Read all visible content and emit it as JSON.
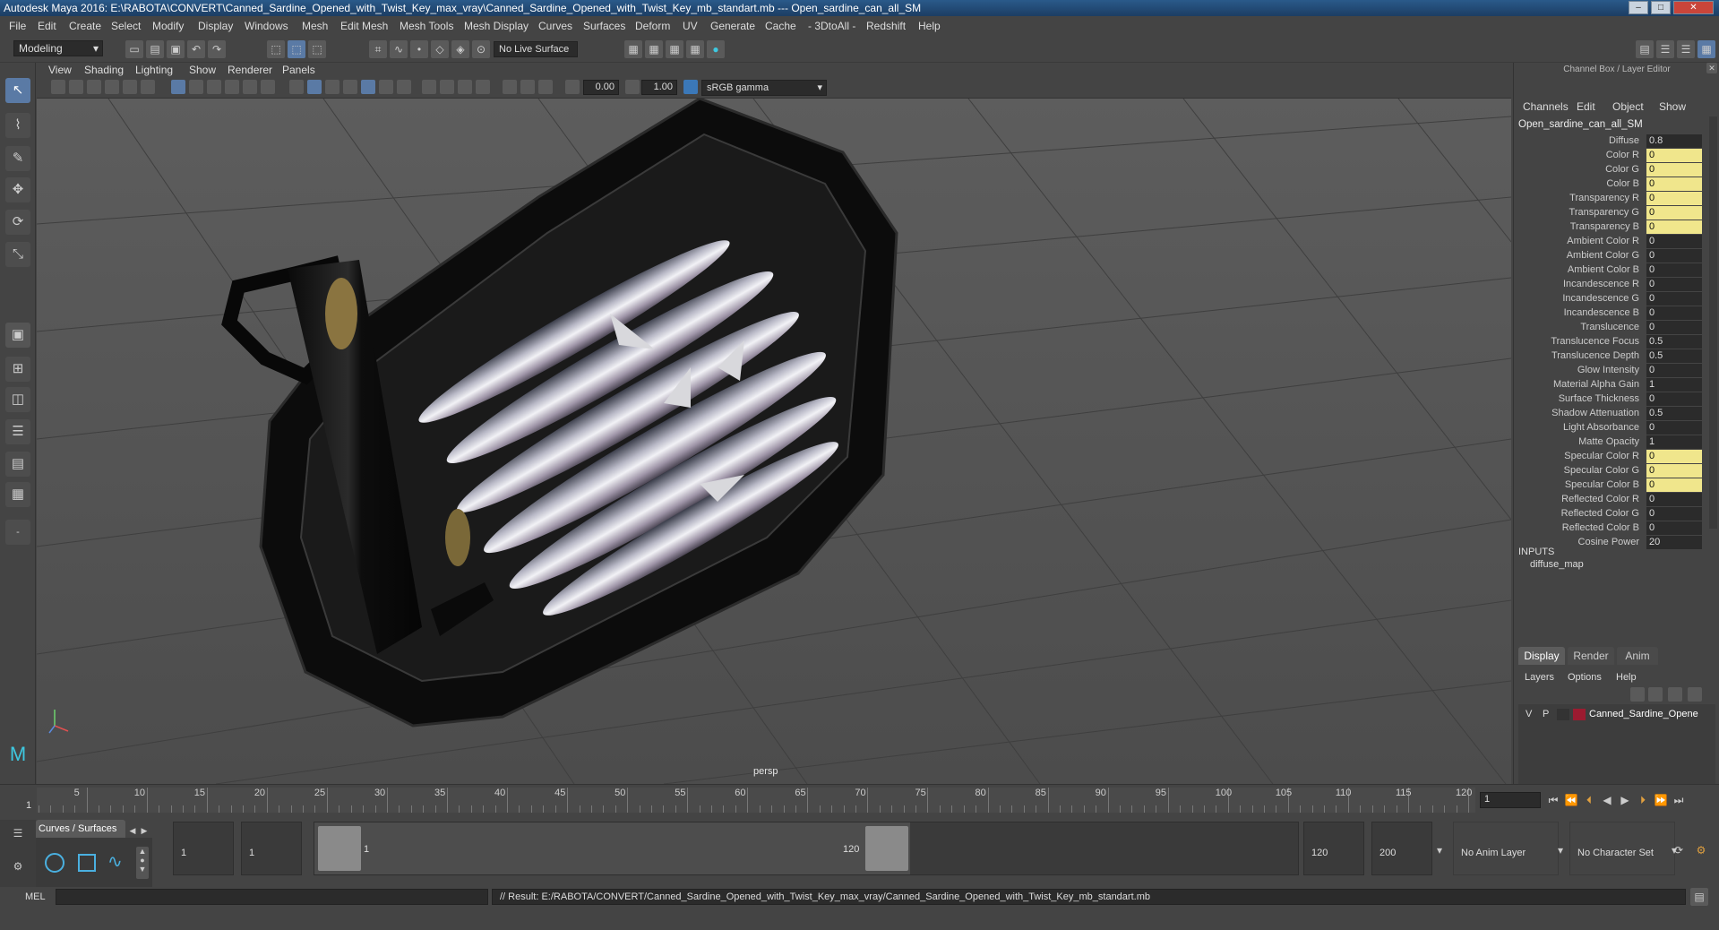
{
  "window": {
    "title": "Autodesk Maya 2016: E:\\RABOTA\\CONVERT\\Canned_Sardine_Opened_with_Twist_Key_max_vray\\Canned_Sardine_Opened_with_Twist_Key_mb_standart.mb  ---   Open_sardine_can_all_SM"
  },
  "menu": [
    "File",
    "Edit",
    "Create",
    "Select",
    "Modify",
    "Display",
    "Windows",
    "Mesh",
    "Edit Mesh",
    "Mesh Tools",
    "Mesh Display",
    "Curves",
    "Surfaces",
    "Deform",
    "UV",
    "Generate",
    "Cache",
    "- 3DtoAll -",
    "Redshift",
    "Help"
  ],
  "status": {
    "mode": "Modeling",
    "live_surface": "No Live Surface"
  },
  "viewport": {
    "menu": [
      "View",
      "Shading",
      "Lighting",
      "Show",
      "Renderer",
      "Panels"
    ],
    "exposure": "0.00",
    "gamma": "1.00",
    "color_space": "sRGB gamma",
    "camera": "persp"
  },
  "channel_box": {
    "title": "Channel Box / Layer Editor",
    "menu": [
      "Channels",
      "Edit",
      "Object",
      "Show"
    ],
    "object": "Open_sardine_can_all_SM",
    "attributes": [
      {
        "label": "Diffuse",
        "value": "0.8",
        "highlight": false
      },
      {
        "label": "Color R",
        "value": "0",
        "highlight": true
      },
      {
        "label": "Color G",
        "value": "0",
        "highlight": true
      },
      {
        "label": "Color B",
        "value": "0",
        "highlight": true
      },
      {
        "label": "Transparency R",
        "value": "0",
        "highlight": true
      },
      {
        "label": "Transparency G",
        "value": "0",
        "highlight": true
      },
      {
        "label": "Transparency B",
        "value": "0",
        "highlight": true
      },
      {
        "label": "Ambient Color R",
        "value": "0",
        "highlight": false
      },
      {
        "label": "Ambient Color G",
        "value": "0",
        "highlight": false
      },
      {
        "label": "Ambient Color B",
        "value": "0",
        "highlight": false
      },
      {
        "label": "Incandescence R",
        "value": "0",
        "highlight": false
      },
      {
        "label": "Incandescence G",
        "value": "0",
        "highlight": false
      },
      {
        "label": "Incandescence B",
        "value": "0",
        "highlight": false
      },
      {
        "label": "Translucence",
        "value": "0",
        "highlight": false
      },
      {
        "label": "Translucence Focus",
        "value": "0.5",
        "highlight": false
      },
      {
        "label": "Translucence Depth",
        "value": "0.5",
        "highlight": false
      },
      {
        "label": "Glow Intensity",
        "value": "0",
        "highlight": false
      },
      {
        "label": "Material Alpha Gain",
        "value": "1",
        "highlight": false
      },
      {
        "label": "Surface Thickness",
        "value": "0",
        "highlight": false
      },
      {
        "label": "Shadow Attenuation",
        "value": "0.5",
        "highlight": false
      },
      {
        "label": "Light Absorbance",
        "value": "0",
        "highlight": false
      },
      {
        "label": "Matte Opacity",
        "value": "1",
        "highlight": false
      },
      {
        "label": "Specular Color R",
        "value": "0",
        "highlight": true
      },
      {
        "label": "Specular Color G",
        "value": "0",
        "highlight": true
      },
      {
        "label": "Specular Color B",
        "value": "0",
        "highlight": true
      },
      {
        "label": "Reflected Color R",
        "value": "0",
        "highlight": false
      },
      {
        "label": "Reflected Color G",
        "value": "0",
        "highlight": false
      },
      {
        "label": "Reflected Color B",
        "value": "0",
        "highlight": false
      },
      {
        "label": "Cosine Power",
        "value": "20",
        "highlight": false
      }
    ],
    "inputs_label": "INPUTS",
    "inputs_item": "diffuse_map"
  },
  "layer_editor": {
    "tabs": [
      "Display",
      "Render",
      "Anim"
    ],
    "menu": [
      "Layers",
      "Options",
      "Help"
    ],
    "layer": {
      "v": "V",
      "p": "P",
      "name": "Canned_Sardine_Opene",
      "color": "#9b1b30"
    }
  },
  "timeline": {
    "ticks": [
      "5",
      "10",
      "15",
      "20",
      "25",
      "30",
      "35",
      "40",
      "45",
      "50",
      "55",
      "60",
      "65",
      "70",
      "75",
      "80",
      "85",
      "90",
      "95",
      "100",
      "105",
      "110",
      "115",
      "120"
    ],
    "start_marker": "1",
    "current_frame": "1"
  },
  "range": {
    "shelf_tab": "Curves / Surfaces",
    "start": "1",
    "start2": "1",
    "slider_start": "1",
    "slider_end": "120",
    "end": "120",
    "end2": "200",
    "anim_layer": "No Anim Layer",
    "char_set": "No Character Set"
  },
  "cmd": {
    "lang": "MEL",
    "result": "// Result: E:/RABOTA/CONVERT/Canned_Sardine_Opened_with_Twist_Key_max_vray/Canned_Sardine_Opened_with_Twist_Key_mb_standart.mb"
  }
}
